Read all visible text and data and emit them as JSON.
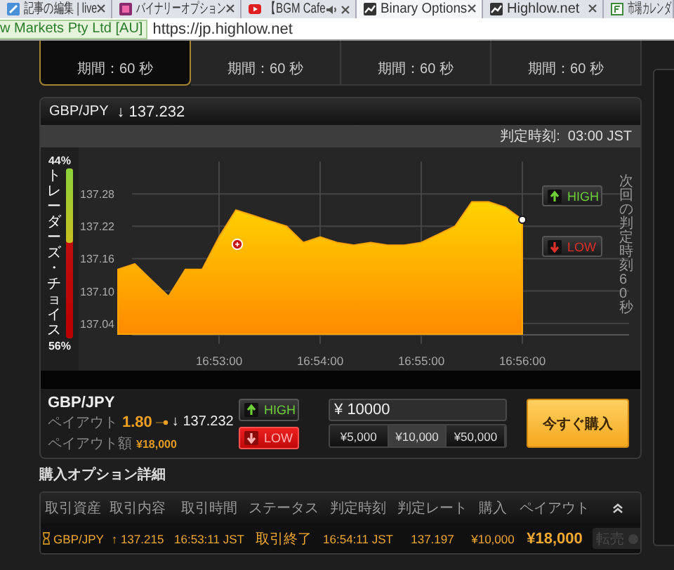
{
  "browser": {
    "tabs": [
      {
        "label": "記事の編集 | live",
        "kind": "pencil",
        "selected": false,
        "audio": false,
        "closable": true
      },
      {
        "label": "バイナリーオプション",
        "kind": "square",
        "selected": false,
        "audio": false,
        "closable": true
      },
      {
        "label": "【BGM Cafe",
        "kind": "video",
        "selected": false,
        "audio": true,
        "closable": true
      },
      {
        "label": "Binary Options",
        "kind": "chart",
        "selected": true,
        "audio": false,
        "closable": true
      },
      {
        "label": "Highlow.net",
        "kind": "chart",
        "selected": false,
        "audio": false,
        "closable": true
      },
      {
        "label": "市場カレンダ",
        "kind": "page",
        "selected": false,
        "audio": false,
        "closable": false
      }
    ],
    "security_badge": "w Markets Pty Ltd [AU]",
    "url": "https://jp.highlow.net"
  },
  "option_cards": [
    {
      "duration": "期間：60 秒",
      "selected": true
    },
    {
      "duration": "期間：60 秒",
      "selected": false
    },
    {
      "duration": "期間：60 秒",
      "selected": false
    },
    {
      "duration": "期間：60 秒",
      "selected": false
    }
  ],
  "chart_panel": {
    "pair": "GBP/JPY",
    "price": "↓ 137.232",
    "expiry": "判定時刻:  03:00 JST",
    "trader_choice": {
      "title": "トレーダーズ・チョイス",
      "high_share": "44%",
      "low_share": "56%",
      "level": 0.44
    },
    "next_expiry": "次回の判定時刻 60 秒",
    "buttons": [
      {
        "label": "HIGH",
        "kind": "high"
      },
      {
        "label": "LOW",
        "kind": "low"
      }
    ],
    "chart_data": {
      "type": "area",
      "categories": [
        null,
        null,
        null,
        null,
        null,
        null,
        "16:53:00",
        null,
        null,
        null,
        null,
        null,
        "16:54:00",
        null,
        null,
        null,
        null,
        null,
        "16:55:00",
        null,
        null,
        null,
        null,
        null,
        "16:56:00"
      ],
      "series": [
        {
          "color": "#ffa500",
          "values": [
            137.14,
            137.15,
            137.12,
            137.09,
            137.14,
            137.14,
            137.2,
            137.25,
            137.24,
            137.23,
            137.22,
            137.19,
            137.2,
            137.19,
            137.185,
            137.19,
            137.185,
            137.185,
            137.19,
            137.205,
            137.22,
            137.265,
            137.265,
            137.255,
            137.232
          ]
        }
      ],
      "grid": true,
      "ylim": [
        137.02,
        137.34
      ],
      "yticks": [
        {
          "value": 137.04,
          "label": "137.04"
        },
        {
          "value": 137.1,
          "label": "137.10"
        },
        {
          "value": 137.16,
          "label": "137.16"
        },
        {
          "value": 137.22,
          "label": "137.22"
        },
        {
          "value": 137.28,
          "label": "137.28"
        }
      ]
    }
  },
  "trade": {
    "pair": "GBP/JPY",
    "payout_label": "ペイアウト",
    "payout_rate": "1.80",
    "payout_amount_label": "ペイアウト額",
    "payout_amount": "¥18,000",
    "price": "↓ 137.232",
    "sides": [
      {
        "label": "HIGH",
        "kind": "high",
        "selected": false
      },
      {
        "label": "LOW",
        "kind": "low",
        "selected": true
      }
    ],
    "amount": "¥ 10000",
    "presets": [
      {
        "label": "¥5,000",
        "selected": false
      },
      {
        "label": "¥10,000",
        "selected": true
      },
      {
        "label": "¥50,000",
        "selected": false
      }
    ],
    "buy_button": "今すぐ購入"
  },
  "history": {
    "title": "購入オプション詳細",
    "columns": [
      "取引資産",
      "取引内容",
      "取引時間",
      "ステータス",
      "判定時刻",
      "判定レート",
      "購入",
      "ペイアウト"
    ],
    "rows": [
      {
        "asset": "GBP/JPY",
        "strike": "↑ 137.215",
        "trade_time": "16:53:11 JST",
        "status": "取引終了",
        "expiry_time": "16:54:11 JST",
        "expiry_rate": "137.197",
        "purchase": "¥10,000",
        "payout": "¥18,000",
        "action": {
          "label": "転売",
          "disabled": true
        }
      }
    ]
  }
}
